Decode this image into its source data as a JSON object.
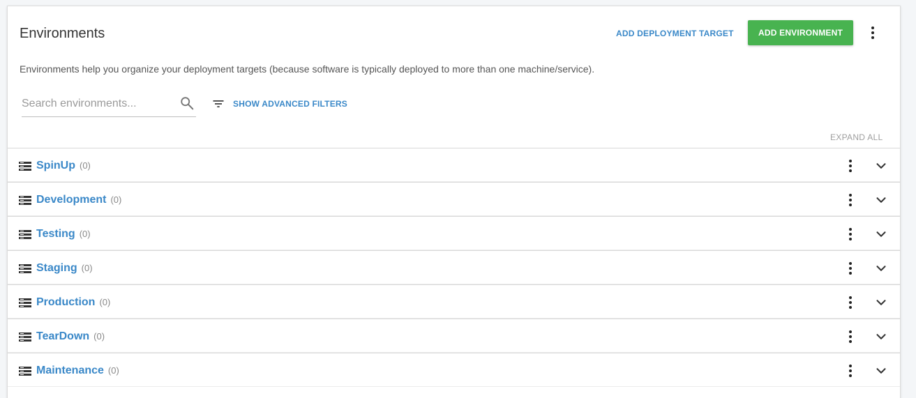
{
  "header": {
    "title": "Environments",
    "add_target_label": "ADD DEPLOYMENT TARGET",
    "add_environment_label": "ADD ENVIRONMENT"
  },
  "description": "Environments help you organize your deployment targets (because software is typically deployed to more than one machine/service).",
  "search": {
    "placeholder": "Search environments...",
    "value": ""
  },
  "filters": {
    "label": "SHOW ADVANCED FILTERS"
  },
  "expand_all_label": "EXPAND ALL",
  "environments": [
    {
      "name": "SpinUp",
      "count": "(0)"
    },
    {
      "name": "Development",
      "count": "(0)"
    },
    {
      "name": "Testing",
      "count": "(0)"
    },
    {
      "name": "Staging",
      "count": "(0)"
    },
    {
      "name": "Production",
      "count": "(0)"
    },
    {
      "name": "TearDown",
      "count": "(0)"
    },
    {
      "name": "Maintenance",
      "count": "(0)"
    }
  ],
  "icons": {
    "search": "search-icon",
    "filter": "filter-icon",
    "environment": "server-stack-icon",
    "menu": "more-vertical-icon",
    "expand": "chevron-down-icon"
  },
  "colors": {
    "primary_link": "#3a88c8",
    "success_button": "#48b350",
    "muted_text": "#9e9e9e"
  }
}
